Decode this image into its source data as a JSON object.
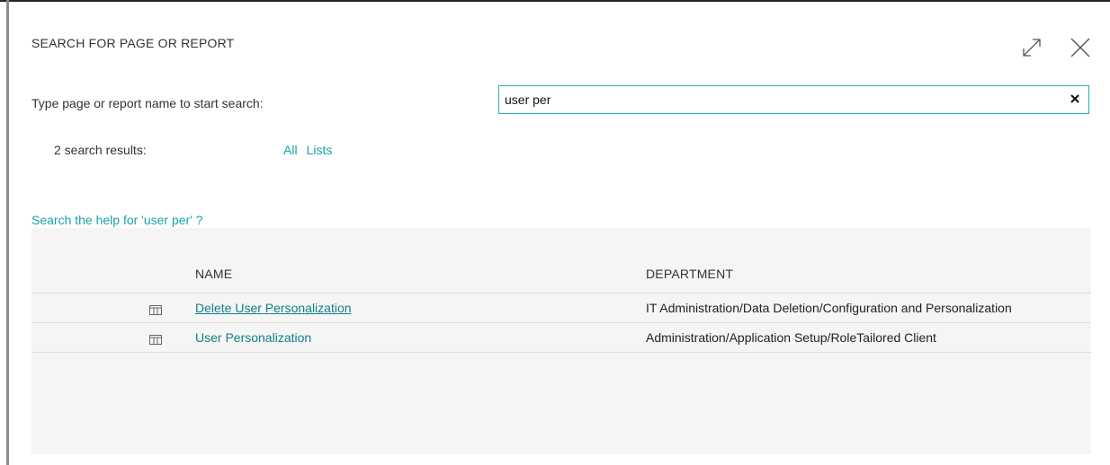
{
  "dialog": {
    "title": "SEARCH FOR PAGE OR REPORT",
    "icons": {
      "expand": "expand-icon",
      "close": "close-icon"
    }
  },
  "search": {
    "prompt_label": "Type page or report name to start search:",
    "value": "user per",
    "placeholder": "",
    "clear_icon": "clear-icon"
  },
  "results": {
    "count_label": "2 search results:",
    "filters": [
      {
        "label": "All"
      },
      {
        "label": "Lists"
      }
    ],
    "help_link": "Search the help for 'user per' ?"
  },
  "table": {
    "columns": {
      "name": "NAME",
      "department": "DEPARTMENT"
    },
    "rows": [
      {
        "icon": "list-page-icon",
        "name": "Delete User Personalization",
        "department": "IT Administration/Data Deletion/Configuration and Personalization",
        "selected": true
      },
      {
        "icon": "list-page-icon",
        "name": "User Personalization",
        "department": "Administration/Application Setup/RoleTailored Client",
        "selected": false
      }
    ]
  },
  "colors": {
    "accent": "#19a3a8",
    "link_row": "#0f7f87",
    "input_border": "#25b2b3",
    "grid_background": "#f5f5f5"
  }
}
